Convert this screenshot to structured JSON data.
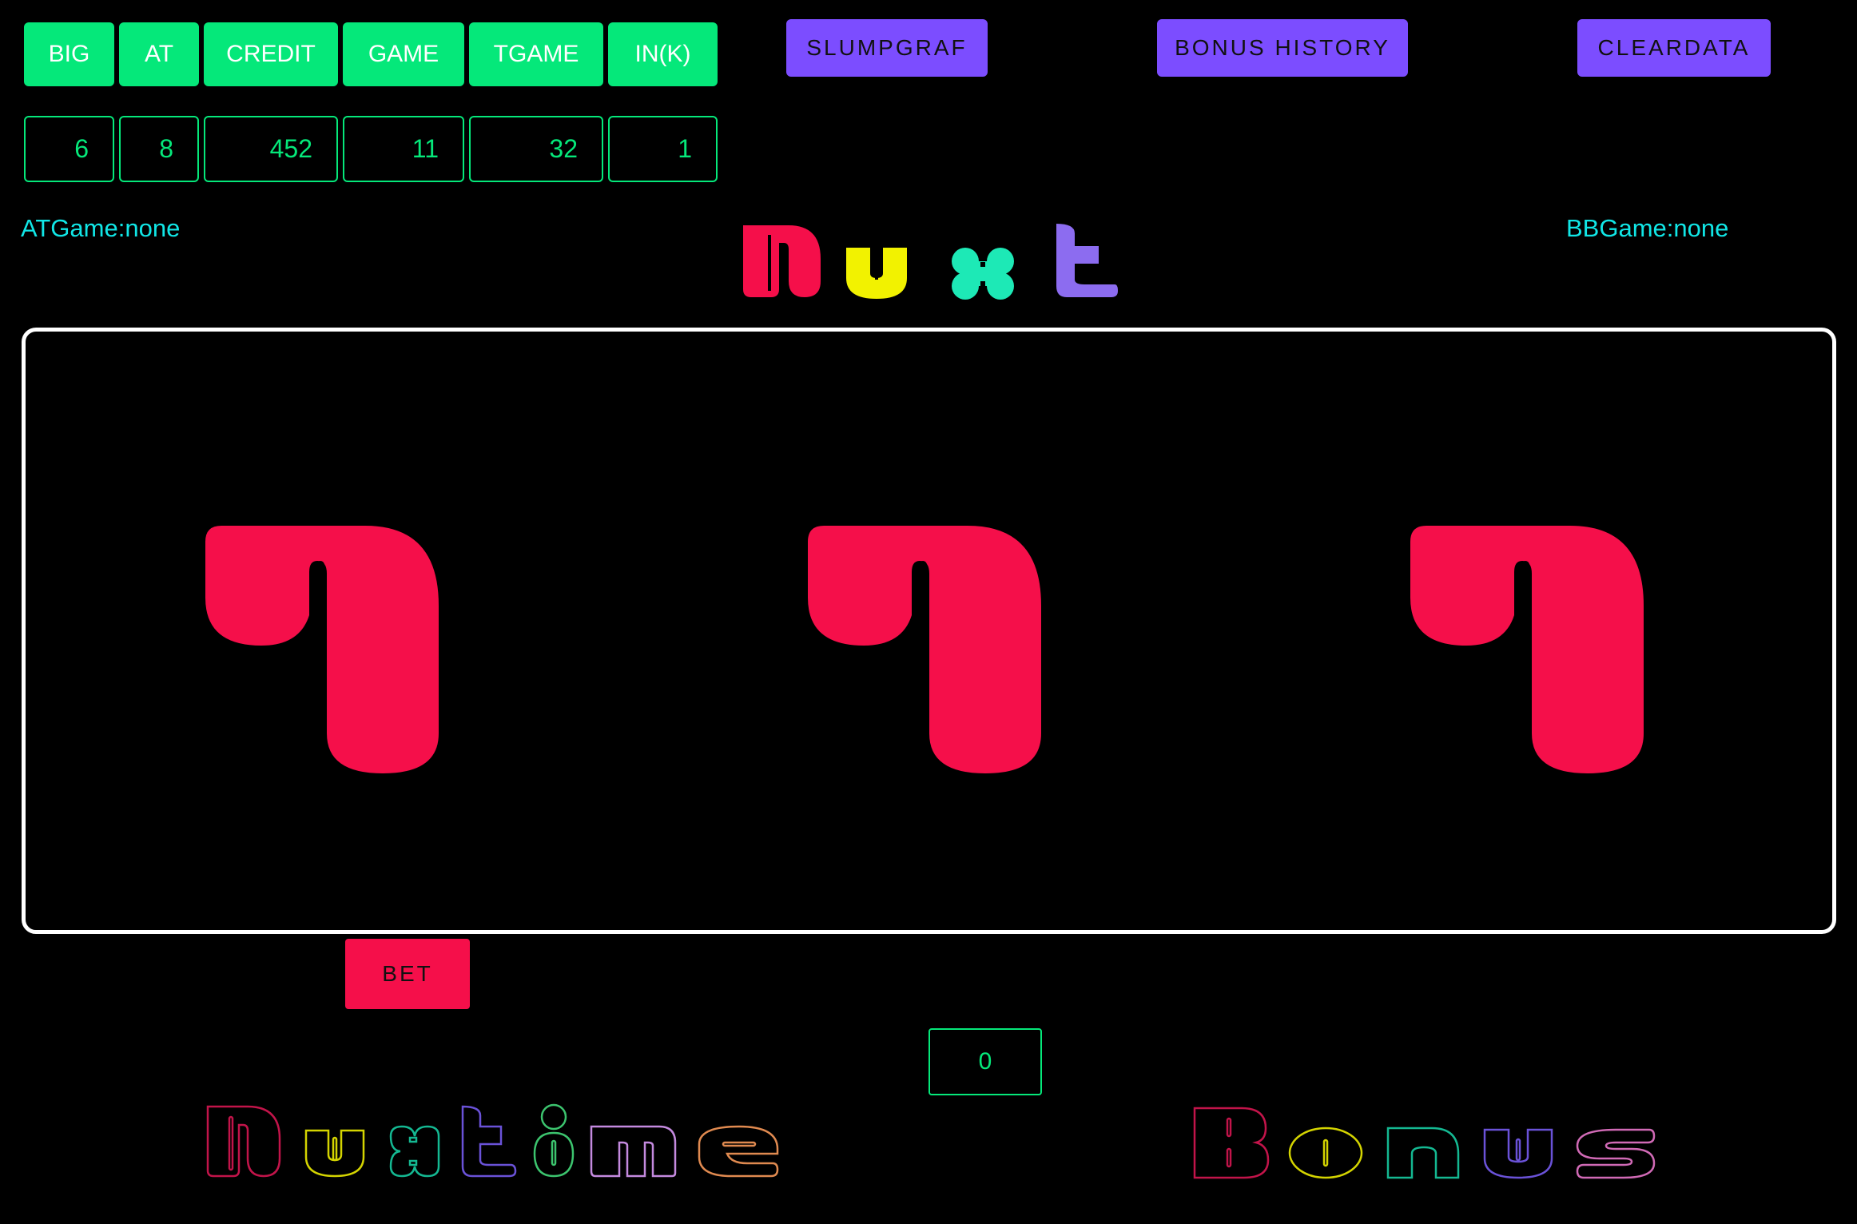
{
  "stats": {
    "headers": [
      "BIG",
      "AT",
      "CREDIT",
      "GAME",
      "TGAME",
      "IN(K)"
    ],
    "values": [
      "6",
      "8",
      "452",
      "11",
      "32",
      "1"
    ]
  },
  "buttons": {
    "slumpgraf": "SLUMPGRAF",
    "bonus_history": "BONUS HISTORY",
    "cleardata": "CLEARDATA",
    "bet": "BET"
  },
  "status": {
    "at_game": "ATGame:none",
    "bb_game": "BBGame:none"
  },
  "title_logo": "Nuxt",
  "reels": [
    "7",
    "7",
    "7"
  ],
  "counter": "0",
  "footer_logo_left": "Nuxtime",
  "footer_logo_right": "Bonus",
  "colors": {
    "green": "#05e87a",
    "purple": "#7c4dff",
    "red": "#f50f4a",
    "yellow": "#f2f200",
    "teal": "#1de9b6",
    "lavender": "#8c6cf0",
    "cyan": "#11e6e6"
  }
}
